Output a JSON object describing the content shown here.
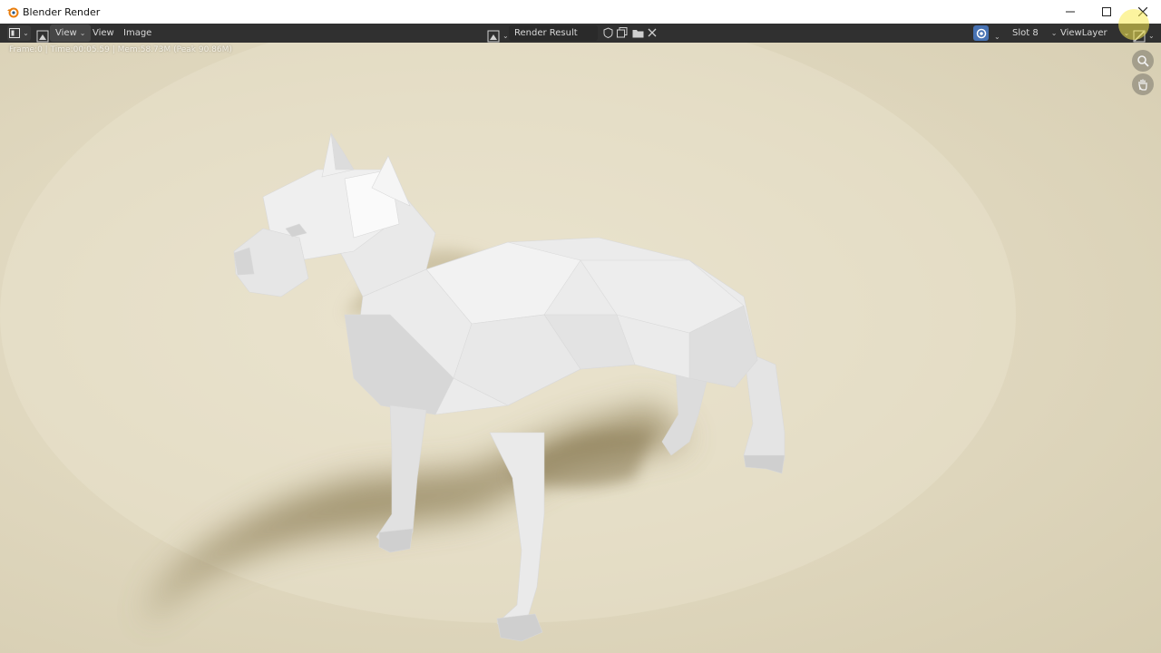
{
  "window": {
    "title": "Blender Render",
    "controls": [
      "minimize-icon",
      "maximize-icon",
      "close-icon"
    ]
  },
  "header": {
    "menus": [
      {
        "label": "View",
        "has_dropdown": true
      },
      {
        "label": "View",
        "has_dropdown": false
      },
      {
        "label": "Image",
        "has_dropdown": false
      }
    ],
    "image_name": "Render Result",
    "slot": "Slot 8",
    "view_layer": "ViewLayer",
    "accent_color": "#4772b3"
  },
  "viewport": {
    "info": "Frame:0 | Time:00:05.59 | Mem:58.73M (Peak 90.86M)",
    "background_color": "#e0d8bf",
    "subject": "low-poly white dog render"
  }
}
